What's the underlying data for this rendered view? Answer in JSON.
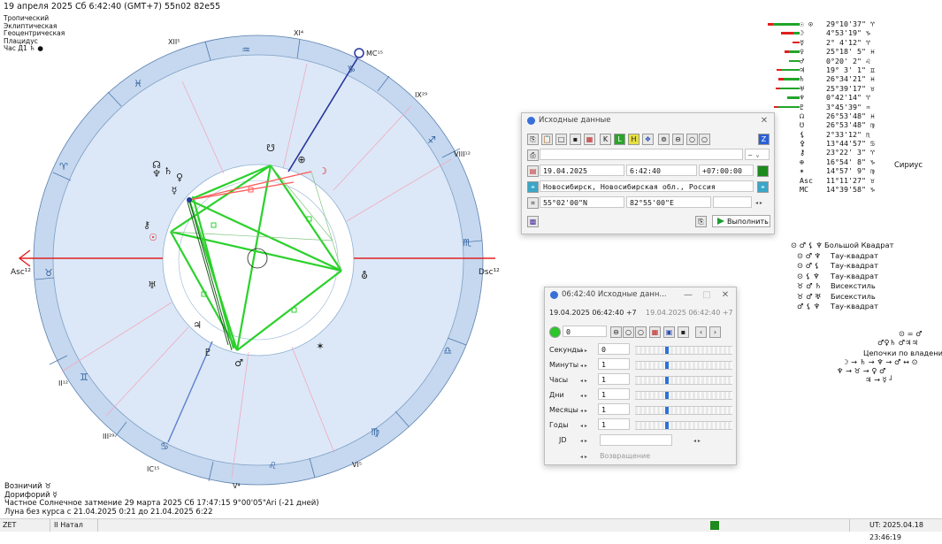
{
  "header": {
    "title": "19 апреля 2025  Сб   6:42:40 (GMT+7) 55n02  82e55"
  },
  "info": [
    "Тропический",
    "Эклиптическая",
    "Геоцентрическая",
    "Плацидус",
    "Час Д1  ♄  ●"
  ],
  "chart": {
    "asc_label": "Asc¹²",
    "dsc_label": "Dsc¹²",
    "mc_label": "MC¹⁵",
    "ic_label": "IC¹⁵",
    "houses": [
      "XII⁵",
      "XI⁴",
      "IX²⁹",
      "VIII¹²",
      "VI⁵",
      "V⁴",
      "III²⁹",
      "II¹²"
    ],
    "signs": [
      "♈",
      "♉",
      "♊",
      "♋",
      "♌",
      "♍",
      "♎",
      "♏",
      "♐",
      "♑",
      "♒",
      "♓"
    ],
    "planets": [
      "☊",
      "♆",
      "♄",
      "♀",
      "☿",
      "⚷",
      "☉",
      "♅",
      "♃",
      "♇",
      "♂",
      "☋",
      "⛢",
      "✶",
      "⊕",
      "☽"
    ],
    "colors": {
      "ring": "#c5d8ef",
      "inner": "#dce8f7",
      "aspect_green": "#2bd12b",
      "aspect_red": "#ff5a5a",
      "axis_red": "#e22020",
      "axis_blue": "#26349c"
    }
  },
  "planet_table": [
    {
      "sym": "☉ ⊙",
      "pos": "29°10'37\" ♈",
      "bars": [
        [
          "g",
          30
        ],
        [
          "r",
          6
        ]
      ]
    },
    {
      "sym": "☽",
      "pos": " 4°53'19\" ♑",
      "bars": [
        [
          "g",
          7
        ],
        [
          "r",
          14
        ]
      ]
    },
    {
      "sym": "☿",
      "pos": " 2° 4'12\" ♈",
      "bars": [
        [
          "r",
          8
        ]
      ]
    },
    {
      "sym": "♀",
      "pos": "25°18' 5\" ♓",
      "bars": [
        [
          "g",
          12
        ],
        [
          "r",
          5
        ]
      ]
    },
    {
      "sym": "♂",
      "pos": " 0°20' 2\" ♌",
      "bars": [
        [
          "g",
          12
        ]
      ]
    },
    {
      "sym": "♃",
      "pos": "19° 3' 1\" ♊",
      "bars": [
        [
          "g",
          20
        ],
        [
          "r",
          6
        ]
      ]
    },
    {
      "sym": "♄",
      "pos": "26°34'21\" ♓",
      "bars": [
        [
          "g",
          18
        ],
        [
          "r",
          6
        ]
      ]
    },
    {
      "sym": "♅",
      "pos": "25°39'17\" ♉",
      "bars": [
        [
          "g",
          22
        ],
        [
          "r",
          5
        ]
      ]
    },
    {
      "sym": "♆",
      "pos": " 0°42'14\" ♈",
      "bars": [
        [
          "g",
          14
        ]
      ]
    },
    {
      "sym": "♇",
      "pos": " 3°45'39\" ♒",
      "bars": [
        [
          "g",
          24
        ],
        [
          "r",
          5
        ]
      ]
    },
    {
      "sym": "☊",
      "pos": "26°53'48\" ♓",
      "bars": []
    },
    {
      "sym": "☋",
      "pos": "26°53'48\" ♍",
      "bars": []
    },
    {
      "sym": "⚸",
      "pos": " 2°33'12\" ♏",
      "bars": []
    },
    {
      "sym": "⚴",
      "pos": "13°44'57\" ♋",
      "bars": []
    },
    {
      "sym": "⚷",
      "pos": "23°22' 3\" ♈",
      "bars": []
    },
    {
      "sym": "⊕",
      "pos": "16°54' 8\" ♑",
      "bars": []
    },
    {
      "sym": "✶",
      "pos": "14°57' 9\" ♍",
      "bars": []
    },
    {
      "sym": "Asc",
      "pos": "11°11'27\" ♉",
      "bars": []
    },
    {
      "sym": "MC",
      "pos": "14°39'58\" ♑",
      "bars": []
    }
  ],
  "sirius": "Сириус",
  "aspects": [
    {
      "s": "⊙ ♂ ⚸ ♆",
      "t": "Большой Квадрат"
    },
    {
      "s": "⊙ ♂ ♆",
      "t": "Тау-квадрат"
    },
    {
      "s": "⊙ ♂ ⚸",
      "t": "Тау-квадрат"
    },
    {
      "s": "⊙ ⚸ ♆",
      "t": "Тау-квадрат"
    },
    {
      "s": "♉ ♂ ♄",
      "t": "Висекстиль"
    },
    {
      "s": "♉ ♂ ♅",
      "t": "Бисекстиль"
    },
    {
      "s": "♂ ⚸ ♆",
      "t": "Тау-квадрат"
    }
  ],
  "chains": {
    "top": "⊙ = ♂",
    "mid": "♂♀♄  ♂♃♃",
    "title": "Цепочки по владению",
    "c1": "☽ → ♄ → ♆ → ♂ ↔ ⊙",
    "c2": "♆ → ♉ → ♀ ♂",
    "c3": "♃ → ☿ ┘"
  },
  "bottom": [
    "Возничий  ♉",
    "Дорифорий  ☿",
    "Частное Солнечное затмение 29 марта 2025 Сб 17:47:15  9°00'05\"Ari (-21 дней)",
    "Луна без курса с 21.04.2025  0:21 до 21.04.2025  6:22"
  ],
  "status": {
    "left": "ZET",
    "mode": "II Натал",
    "time": "UT: 2025.04.18 23:46:19",
    "indicator_color": "#1e8a1e"
  },
  "dialog1": {
    "title": "Исходные данные",
    "date": "19.04.2025",
    "time": "6:42:40",
    "tz": "+07:00:00",
    "place": "Новосибирск, Новосибирская обл., Россия",
    "lat": "55°02'00\"N",
    "lon": "82°55'00\"E",
    "run": "Выполнить",
    "select_value": "—"
  },
  "dialog2": {
    "title": "06:42:40 Исходные данн...",
    "dt1": "19.04.2025  06:42:40  +7",
    "dt2": "19.04.2025  06:42:40  +7",
    "counter": "0",
    "rows": [
      {
        "label": "Секунды",
        "value": "0",
        "knob": 0.33
      },
      {
        "label": "Минуты",
        "value": "1",
        "knob": 0.33
      },
      {
        "label": "Часы",
        "value": "1",
        "knob": 0.33
      },
      {
        "label": "Дни",
        "value": "1",
        "knob": 0.33
      },
      {
        "label": "Месяцы",
        "value": "1",
        "knob": 0.33
      },
      {
        "label": "Годы",
        "value": "1",
        "knob": 0.33
      }
    ],
    "jd": "JD",
    "return": "Возвращение"
  }
}
